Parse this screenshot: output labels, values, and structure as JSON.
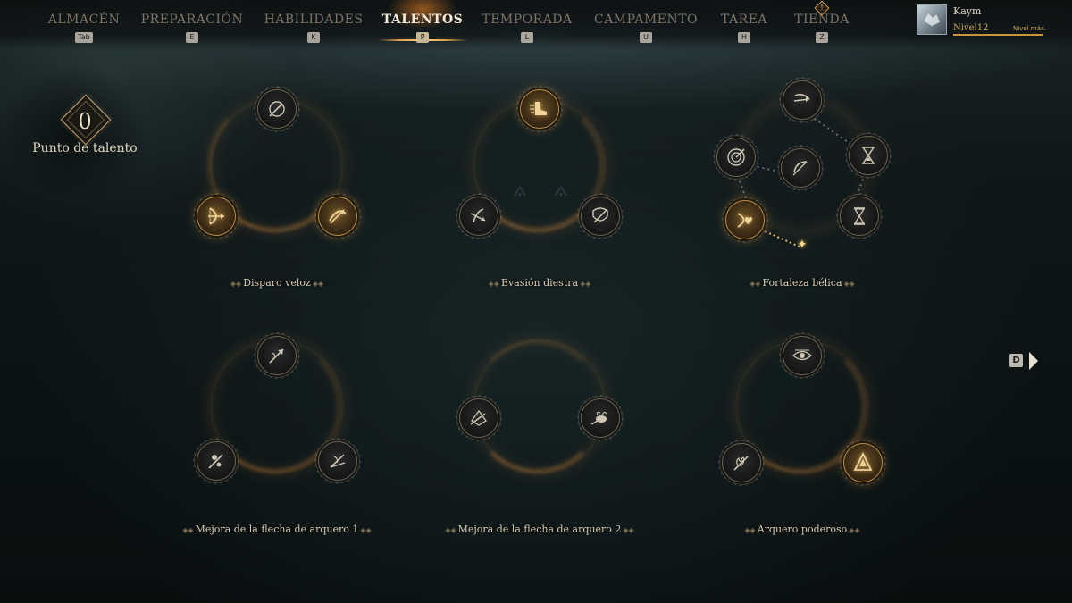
{
  "nav": {
    "tabs": [
      {
        "label": "ALMACÉN",
        "key": "Tab"
      },
      {
        "label": "PREPARACIÓN",
        "key": "E"
      },
      {
        "label": "HABILIDADES",
        "key": "K"
      },
      {
        "label": "TALENTOS",
        "key": "P"
      },
      {
        "label": "TEMPORADA",
        "key": "L"
      },
      {
        "label": "CAMPAMENTO",
        "key": "U"
      },
      {
        "label": "TAREA",
        "key": "H"
      },
      {
        "label": "TIENDA",
        "key": "Z"
      }
    ],
    "active_tab": "TALENTOS",
    "shop_badge": "!"
  },
  "profile": {
    "name": "Kaym",
    "level": "Nivel12",
    "level_status": "Nivel máx.",
    "xp_fraction": 1.0
  },
  "talent_points": {
    "value": "0",
    "label": "Punto de talento"
  },
  "groups": [
    {
      "name": "Disparo veloz",
      "nodes": [
        {
          "icon": "arrow-target-icon",
          "lit": false
        },
        {
          "icon": "bow-draw-icon",
          "lit": true
        },
        {
          "icon": "crossbow-icon",
          "lit": true
        }
      ]
    },
    {
      "name": "Evasión diestra",
      "nodes": [
        {
          "icon": "dash-boot-icon",
          "lit": true
        },
        {
          "icon": "dodge-arrow-icon",
          "lit": false
        },
        {
          "icon": "bow-shield-icon",
          "lit": false
        }
      ]
    },
    {
      "name": "Fortaleza bélica",
      "nodes": [
        {
          "icon": "arrow-shot-icon",
          "lit": false
        },
        {
          "icon": "target-icon",
          "lit": false
        },
        {
          "icon": "center-arrow-icon",
          "lit": false
        },
        {
          "icon": "hourglass-icon",
          "lit": false
        },
        {
          "icon": "heart-bow-icon",
          "lit": true
        },
        {
          "icon": "sand-timer-icon",
          "lit": false
        }
      ]
    },
    {
      "name": "Mejora de la flecha de arquero 1",
      "nodes": [
        {
          "icon": "arrow-wind-icon",
          "lit": false
        },
        {
          "icon": "poison-arrow-icon",
          "lit": false
        },
        {
          "icon": "split-arrow-icon",
          "lit": false
        }
      ]
    },
    {
      "name": "Mejora de la flecha de arquero 2",
      "nodes": [
        {
          "icon": "ice-arrow-icon",
          "lit": false
        },
        {
          "icon": "bee-arrow-icon",
          "lit": false
        }
      ]
    },
    {
      "name": "Arquero poderoso",
      "nodes": [
        {
          "icon": "eye-arrow-icon",
          "lit": false
        },
        {
          "icon": "fire-arrow-icon",
          "lit": false
        },
        {
          "icon": "rune-a-icon",
          "lit": true
        }
      ]
    }
  ],
  "next_page": {
    "key": "D"
  },
  "colors": {
    "accent_gold": "#c9943a",
    "text_light": "#e2d6bd",
    "tab_inactive": "#7d7466",
    "tab_active": "#f3ead7",
    "background": "#0b1213"
  }
}
